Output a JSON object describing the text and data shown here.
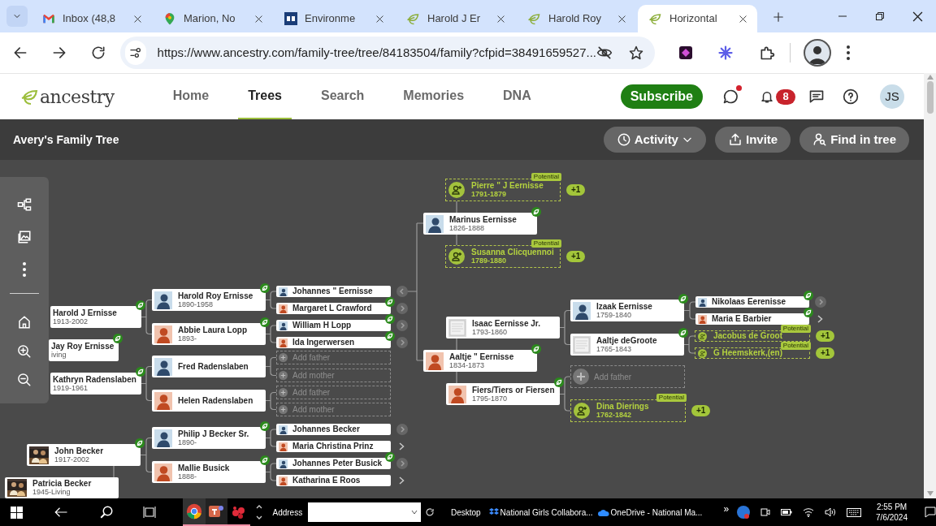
{
  "browser": {
    "tabs": [
      {
        "kind": "gmail",
        "label": "Inbox (48,8",
        "selected": false
      },
      {
        "kind": "maps",
        "label": "Marion, No",
        "selected": false
      },
      {
        "kind": "square",
        "label": "Environme",
        "selected": false
      },
      {
        "kind": "leaf",
        "label": "Harold J Er",
        "selected": false
      },
      {
        "kind": "leaf",
        "label": "Harold Roy",
        "selected": false
      },
      {
        "kind": "leaf",
        "label": "Horizontal",
        "selected": true
      }
    ],
    "url": "https://www.ancestry.com/family-tree/tree/84183504/family?cfpid=38491659527..."
  },
  "header": {
    "logo": "ancestry",
    "nav": [
      {
        "label": "Home",
        "selected": false
      },
      {
        "label": "Trees",
        "selected": true
      },
      {
        "label": "Search",
        "selected": false
      },
      {
        "label": "Memories",
        "selected": false
      },
      {
        "label": "DNA",
        "selected": false
      }
    ],
    "subscribe": "Subscribe",
    "notification_count": "8",
    "user_initials": "JS"
  },
  "tree_bar": {
    "title": "Avery's Family Tree",
    "buttons": [
      {
        "kind": "activity",
        "label": "Activity"
      },
      {
        "kind": "invite",
        "label": "Invite"
      },
      {
        "kind": "find",
        "label": "Find in tree"
      }
    ]
  },
  "tree": {
    "nodes": [
      {
        "kind": "plain",
        "name": "Harold J Ernisse",
        "dates": "1913-2002",
        "hint": true
      },
      {
        "kind": "plain",
        "name": "Jay Roy Ernisse",
        "dates": "iving",
        "hint": true
      },
      {
        "kind": "plain",
        "name": "Kathryn Radenslaben",
        "dates": "1919-1961",
        "hint": true
      },
      {
        "name": "John Becker",
        "dates": "1917-2002",
        "hint": true
      },
      {
        "name": "Patricia Becker",
        "dates": "1945-Living",
        "hint": false
      },
      {
        "kind": "male",
        "name": "Harold Roy Ernisse",
        "dates": "1890-1958",
        "hint": true
      },
      {
        "kind": "female",
        "name": "Abbie Laura Lopp",
        "dates": "1893-",
        "hint": true
      },
      {
        "kind": "male",
        "name": "Fred Radenslaben",
        "hint": false
      },
      {
        "kind": "female",
        "name": "Helen Radenslaben",
        "hint": false
      },
      {
        "kind": "male",
        "name": "Philip J Becker Sr.",
        "dates": "1890-",
        "hint": true
      },
      {
        "kind": "female",
        "name": "Mallie Busick",
        "dates": "1888-",
        "hint": true
      },
      {
        "kind": "male",
        "name": "Johannes \" Eernisse",
        "hint": false,
        "nav": {
          "kind": "back"
        }
      },
      {
        "kind": "female",
        "name": "Margaret L Crawford",
        "hint": true,
        "nav": {
          "kind": "circle"
        }
      },
      {
        "kind": "male",
        "name": "William H Lopp",
        "hint": true,
        "nav": {
          "kind": "circle"
        }
      },
      {
        "kind": "female",
        "name": "Ida Ingerwersen",
        "hint": true,
        "nav": {
          "kind": "circle"
        }
      },
      {
        "kind": "add",
        "label": "Add father"
      },
      {
        "kind": "add",
        "label": "Add mother"
      },
      {
        "kind": "add",
        "label": "Add father"
      },
      {
        "kind": "add",
        "label": "Add mother"
      },
      {
        "kind": "male",
        "name": "Johannes Becker",
        "hint": false,
        "nav": {
          "kind": "circle"
        }
      },
      {
        "kind": "female",
        "name": "Maria Christina Prinz",
        "hint": false,
        "nav": {
          "kind": "plain"
        }
      },
      {
        "kind": "male",
        "name": "Johannes Peter Busick",
        "hint": true,
        "nav": {
          "kind": "circle"
        }
      },
      {
        "kind": "female",
        "name": "Katharina E Roos",
        "hint": false,
        "nav": {
          "kind": "plain"
        }
      },
      {
        "kind": "potential",
        "name": "Pierre \" J Eernisse",
        "dates": "1791-1879",
        "badge": "Potential",
        "extra": "+1"
      },
      {
        "kind": "male",
        "name": "Marinus Eernisse",
        "dates": "1826-1888",
        "hint": true
      },
      {
        "kind": "potential",
        "name": "Susanna Clicquennoi",
        "dates": "1789-1880",
        "badge": "Potential",
        "extra": "+1"
      },
      {
        "kind": "document",
        "name": "Isaac Eernisse Jr.",
        "dates": "1793-1860",
        "hint": false
      },
      {
        "kind": "female",
        "name": "Aaltje \" Eernisse",
        "dates": "1834-1873",
        "hint": true
      },
      {
        "kind": "female",
        "name": "Fiers/Tiers or Fiersen",
        "dates": "1795-1870",
        "hint": true
      },
      {
        "kind": "male",
        "name": "Izaak Eernisse",
        "dates": "1759-1840",
        "hint": true
      },
      {
        "kind": "document",
        "name": "Aaltje deGroote",
        "dates": "1765-1843",
        "hint": true
      },
      {
        "kind": "male",
        "name": "Nikolaas Eerenisse",
        "hint": true,
        "nav": {
          "kind": "circle"
        }
      },
      {
        "kind": "female",
        "name": "Maria E Barbier",
        "hint": true,
        "nav": {
          "kind": "plain"
        }
      },
      {
        "kind": "potential",
        "name": "Jacobus de Groot",
        "badge": "Potential",
        "extra": "+1"
      },
      {
        "kind": "potential",
        "name": "G Heemskerk,(en)",
        "badge": "Potential",
        "extra": "+1"
      },
      {
        "kind": "add",
        "label": "Add father"
      },
      {
        "kind": "potential",
        "name": "Dina Dierings",
        "dates": "1762-1842",
        "badge": "Potential",
        "extra": "+1"
      }
    ]
  },
  "taskbar": {
    "address_label": "Address",
    "desktop_label": "Desktop",
    "toolbar_items": [
      {
        "kind": "dropbox",
        "label": "National Girls Collabora..."
      },
      {
        "kind": "onedrive",
        "label": "OneDrive - National Ma..."
      }
    ],
    "overflow": "»",
    "time": "2:55 PM",
    "date": "7/6/2024"
  }
}
